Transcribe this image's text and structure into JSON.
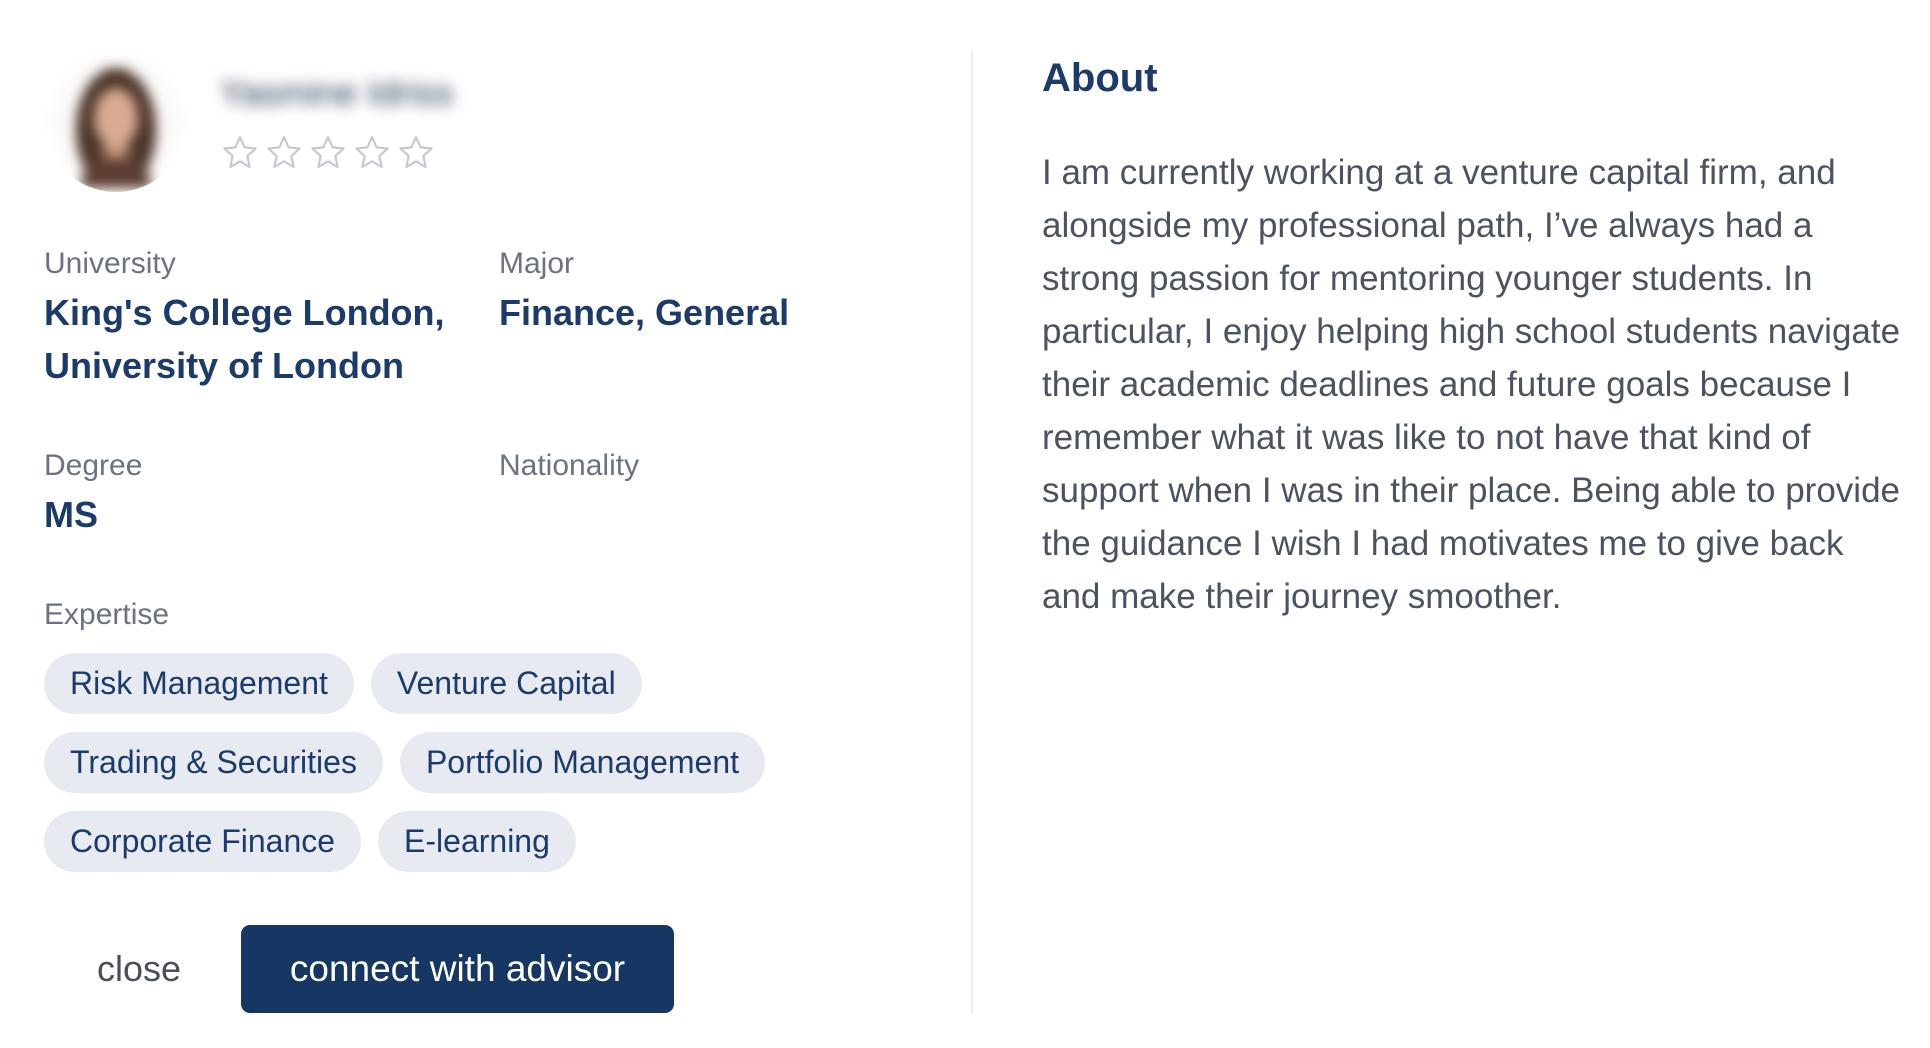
{
  "profile": {
    "name": "Yasmine Idriss",
    "rating": {
      "value": 0,
      "max": 5
    }
  },
  "fields": {
    "university": {
      "label": "University",
      "value": "King's College London, University of London"
    },
    "major": {
      "label": "Major",
      "value": "Finance, General"
    },
    "degree": {
      "label": "Degree",
      "value": "MS"
    },
    "nationality": {
      "label": "Nationality",
      "value": ""
    }
  },
  "expertise": {
    "label": "Expertise",
    "tags": [
      "Risk Management",
      "Venture Capital",
      "Trading & Securities",
      "Portfolio Management",
      "Corporate Finance",
      "E-learning"
    ]
  },
  "actions": {
    "close_label": "close",
    "connect_label": "connect with advisor"
  },
  "about": {
    "title": "About",
    "text": "I am currently working at a venture capital firm, and alongside my professional path, I’ve always had a strong passion for mentoring younger students. In particular, I enjoy helping high school students navigate their academic deadlines and future goals because I remember what it was like to not have that kind of support when I was in their place. Being able to provide the guidance I wish I had motivates me to give back and make their journey smoother."
  },
  "colors": {
    "primary": "#163763",
    "heading": "#1c3b6b",
    "chip_bg": "#e7ebf1",
    "label": "#6b7280",
    "body_text": "#4b5361",
    "star_outline": "#c5c9cf"
  },
  "icons": {
    "star": "star-outline-icon",
    "avatar": "profile-photo"
  }
}
